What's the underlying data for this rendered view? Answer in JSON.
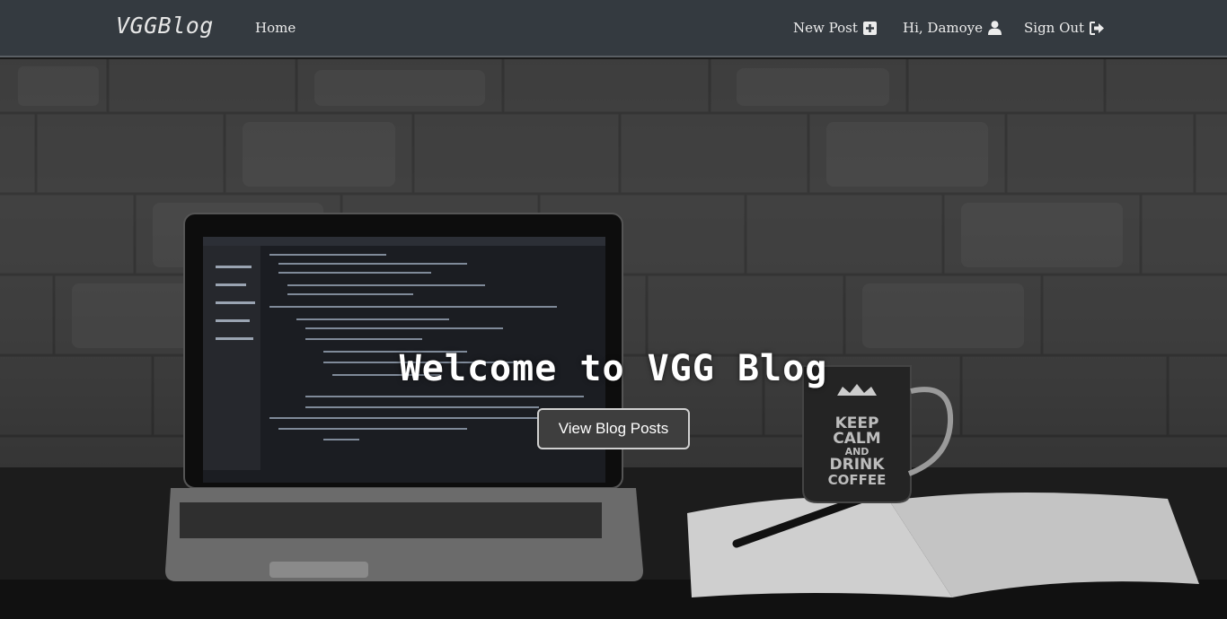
{
  "navbar": {
    "brand": "VGGBlog",
    "home": "Home",
    "new_post": "New Post",
    "greeting": "Hi, Damoye",
    "sign_out": "Sign Out",
    "icons": {
      "new_post": "plus-square-icon",
      "user": "user-icon",
      "sign_out": "sign-out-icon"
    },
    "colors": {
      "background": "#343a40",
      "text": "#ececec"
    }
  },
  "hero": {
    "title": "Welcome to VGG Blog",
    "button_label": "View Blog Posts",
    "mug_text": [
      "KEEP",
      "CALM",
      "AND",
      "DRINK",
      "COFFEE"
    ]
  }
}
